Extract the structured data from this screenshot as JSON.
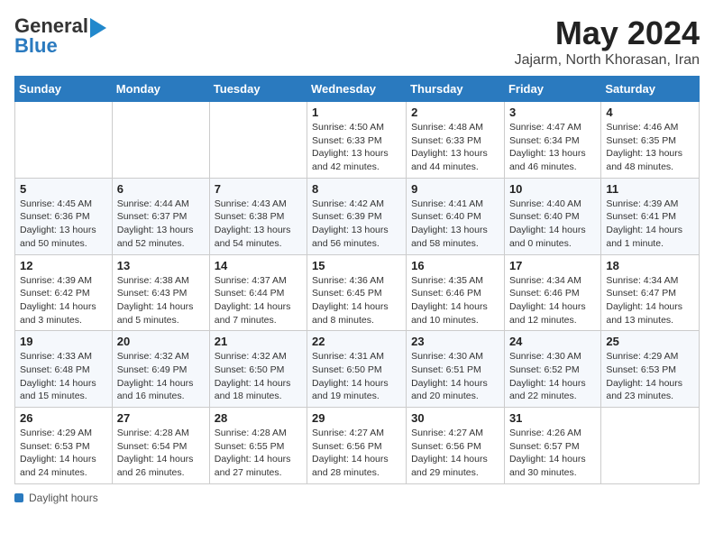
{
  "header": {
    "logo_general": "General",
    "logo_blue": "Blue",
    "title": "May 2024",
    "subtitle": "Jajarm, North Khorasan, Iran"
  },
  "calendar": {
    "days_of_week": [
      "Sunday",
      "Monday",
      "Tuesday",
      "Wednesday",
      "Thursday",
      "Friday",
      "Saturday"
    ],
    "weeks": [
      [
        {
          "day": "",
          "info": ""
        },
        {
          "day": "",
          "info": ""
        },
        {
          "day": "",
          "info": ""
        },
        {
          "day": "1",
          "info": "Sunrise: 4:50 AM\nSunset: 6:33 PM\nDaylight: 13 hours\nand 42 minutes."
        },
        {
          "day": "2",
          "info": "Sunrise: 4:48 AM\nSunset: 6:33 PM\nDaylight: 13 hours\nand 44 minutes."
        },
        {
          "day": "3",
          "info": "Sunrise: 4:47 AM\nSunset: 6:34 PM\nDaylight: 13 hours\nand 46 minutes."
        },
        {
          "day": "4",
          "info": "Sunrise: 4:46 AM\nSunset: 6:35 PM\nDaylight: 13 hours\nand 48 minutes."
        }
      ],
      [
        {
          "day": "5",
          "info": "Sunrise: 4:45 AM\nSunset: 6:36 PM\nDaylight: 13 hours\nand 50 minutes."
        },
        {
          "day": "6",
          "info": "Sunrise: 4:44 AM\nSunset: 6:37 PM\nDaylight: 13 hours\nand 52 minutes."
        },
        {
          "day": "7",
          "info": "Sunrise: 4:43 AM\nSunset: 6:38 PM\nDaylight: 13 hours\nand 54 minutes."
        },
        {
          "day": "8",
          "info": "Sunrise: 4:42 AM\nSunset: 6:39 PM\nDaylight: 13 hours\nand 56 minutes."
        },
        {
          "day": "9",
          "info": "Sunrise: 4:41 AM\nSunset: 6:40 PM\nDaylight: 13 hours\nand 58 minutes."
        },
        {
          "day": "10",
          "info": "Sunrise: 4:40 AM\nSunset: 6:40 PM\nDaylight: 14 hours\nand 0 minutes."
        },
        {
          "day": "11",
          "info": "Sunrise: 4:39 AM\nSunset: 6:41 PM\nDaylight: 14 hours\nand 1 minute."
        }
      ],
      [
        {
          "day": "12",
          "info": "Sunrise: 4:39 AM\nSunset: 6:42 PM\nDaylight: 14 hours\nand 3 minutes."
        },
        {
          "day": "13",
          "info": "Sunrise: 4:38 AM\nSunset: 6:43 PM\nDaylight: 14 hours\nand 5 minutes."
        },
        {
          "day": "14",
          "info": "Sunrise: 4:37 AM\nSunset: 6:44 PM\nDaylight: 14 hours\nand 7 minutes."
        },
        {
          "day": "15",
          "info": "Sunrise: 4:36 AM\nSunset: 6:45 PM\nDaylight: 14 hours\nand 8 minutes."
        },
        {
          "day": "16",
          "info": "Sunrise: 4:35 AM\nSunset: 6:46 PM\nDaylight: 14 hours\nand 10 minutes."
        },
        {
          "day": "17",
          "info": "Sunrise: 4:34 AM\nSunset: 6:46 PM\nDaylight: 14 hours\nand 12 minutes."
        },
        {
          "day": "18",
          "info": "Sunrise: 4:34 AM\nSunset: 6:47 PM\nDaylight: 14 hours\nand 13 minutes."
        }
      ],
      [
        {
          "day": "19",
          "info": "Sunrise: 4:33 AM\nSunset: 6:48 PM\nDaylight: 14 hours\nand 15 minutes."
        },
        {
          "day": "20",
          "info": "Sunrise: 4:32 AM\nSunset: 6:49 PM\nDaylight: 14 hours\nand 16 minutes."
        },
        {
          "day": "21",
          "info": "Sunrise: 4:32 AM\nSunset: 6:50 PM\nDaylight: 14 hours\nand 18 minutes."
        },
        {
          "day": "22",
          "info": "Sunrise: 4:31 AM\nSunset: 6:50 PM\nDaylight: 14 hours\nand 19 minutes."
        },
        {
          "day": "23",
          "info": "Sunrise: 4:30 AM\nSunset: 6:51 PM\nDaylight: 14 hours\nand 20 minutes."
        },
        {
          "day": "24",
          "info": "Sunrise: 4:30 AM\nSunset: 6:52 PM\nDaylight: 14 hours\nand 22 minutes."
        },
        {
          "day": "25",
          "info": "Sunrise: 4:29 AM\nSunset: 6:53 PM\nDaylight: 14 hours\nand 23 minutes."
        }
      ],
      [
        {
          "day": "26",
          "info": "Sunrise: 4:29 AM\nSunset: 6:53 PM\nDaylight: 14 hours\nand 24 minutes."
        },
        {
          "day": "27",
          "info": "Sunrise: 4:28 AM\nSunset: 6:54 PM\nDaylight: 14 hours\nand 26 minutes."
        },
        {
          "day": "28",
          "info": "Sunrise: 4:28 AM\nSunset: 6:55 PM\nDaylight: 14 hours\nand 27 minutes."
        },
        {
          "day": "29",
          "info": "Sunrise: 4:27 AM\nSunset: 6:56 PM\nDaylight: 14 hours\nand 28 minutes."
        },
        {
          "day": "30",
          "info": "Sunrise: 4:27 AM\nSunset: 6:56 PM\nDaylight: 14 hours\nand 29 minutes."
        },
        {
          "day": "31",
          "info": "Sunrise: 4:26 AM\nSunset: 6:57 PM\nDaylight: 14 hours\nand 30 minutes."
        },
        {
          "day": "",
          "info": ""
        }
      ]
    ]
  },
  "footer": {
    "label": "Daylight hours"
  }
}
